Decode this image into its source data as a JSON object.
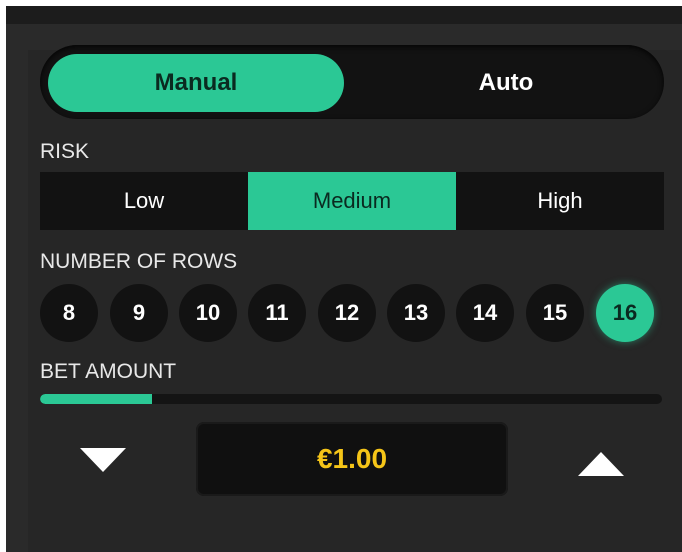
{
  "mode_toggle": {
    "manual_label": "Manual",
    "auto_label": "Auto",
    "selected": "Manual"
  },
  "risk": {
    "label": "RISK",
    "options": [
      "Low",
      "Medium",
      "High"
    ],
    "selected": "Medium"
  },
  "rows": {
    "label": "NUMBER OF ROWS",
    "options": [
      "8",
      "9",
      "10",
      "11",
      "12",
      "13",
      "14",
      "15",
      "16"
    ],
    "selected": "16"
  },
  "bet": {
    "label": "BET AMOUNT",
    "amount": "€1.00",
    "slider_fraction": 0.18
  },
  "icons": {
    "decrease": "triangle-down-icon",
    "increase": "triangle-up-icon"
  },
  "colors": {
    "accent": "#2bc895",
    "accent_text": "#0a2a20",
    "amount_text": "#f5c518",
    "panel_bg": "#262626",
    "control_bg": "#121212"
  }
}
